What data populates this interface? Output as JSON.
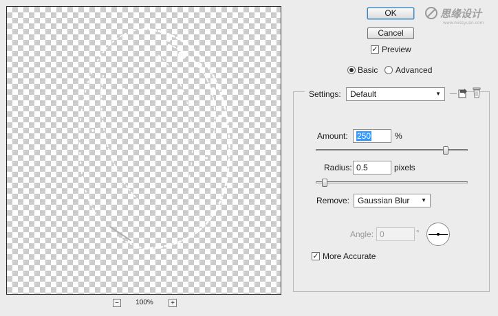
{
  "preview": {
    "zoom_out_label": "−",
    "zoom_level": "100%",
    "zoom_in_label": "+"
  },
  "buttons": {
    "ok": "OK",
    "cancel": "Cancel"
  },
  "preview_option": {
    "label": "Preview",
    "checked": true
  },
  "mode": {
    "basic_label": "Basic",
    "advanced_label": "Advanced",
    "selected": "Basic"
  },
  "settings": {
    "label": "Settings:",
    "value": "Default",
    "save_icon": "save-settings-icon",
    "delete_icon": "trash-icon"
  },
  "amount": {
    "label": "Amount:",
    "value": "250",
    "unit": "%",
    "slider_fraction": 0.87
  },
  "radius": {
    "label": "Radius:",
    "value": "0.5",
    "unit": "pixels",
    "slider_fraction": 0.04
  },
  "remove": {
    "label": "Remove:",
    "value": "Gaussian Blur"
  },
  "angle": {
    "label": "Angle:",
    "value": "0",
    "unit": "°"
  },
  "more_accurate": {
    "label": "More Accurate",
    "checked": true
  },
  "watermark": {
    "text": "思缘设计",
    "site": "www.missyuan.com"
  }
}
